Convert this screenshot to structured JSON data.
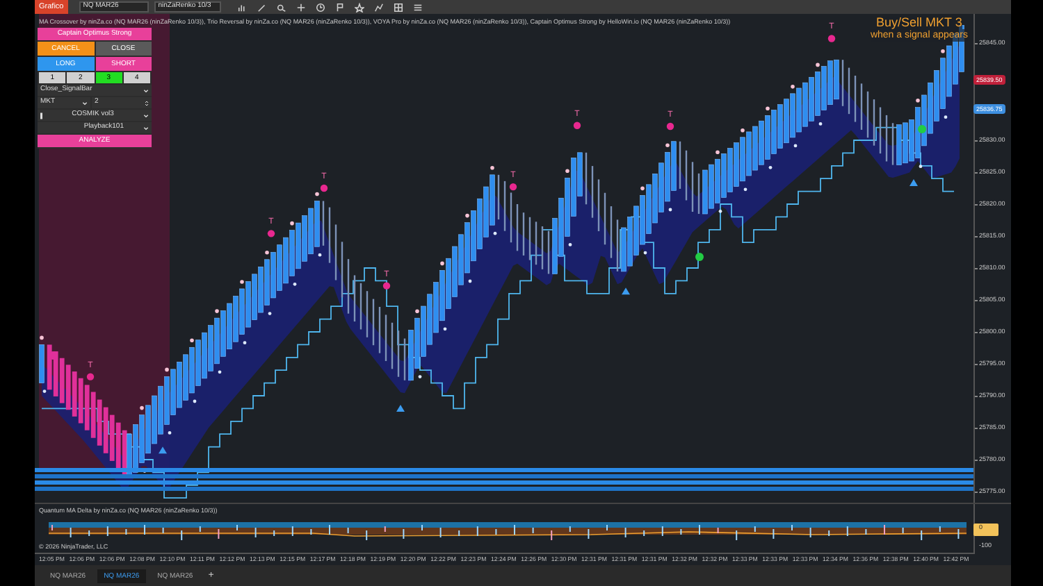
{
  "toolbar": {
    "chart_button": "Grafico",
    "instrument": "NQ MAR26",
    "bar_type": "ninZaRenko 10/3"
  },
  "legend": "MA Crossover by ninZa.co (NQ MAR26 (ninZaRenko 10/3)), Trio Reversal by ninZa.co (NQ MAR26 (ninZaRenko 10/3)), VOYA Pro by ninZa.co (NQ MAR26 (ninZaRenko 10/3)), Captain Optimus Strong by HelloWin.io (NQ MAR26 (ninZaRenko 10/3))",
  "annotation": [
    "Buy/Sell MKT 3",
    "when a signal appears"
  ],
  "panel": {
    "title": "Captain Optimus Strong",
    "buttons": [
      {
        "label": "CANCEL",
        "kind": "cancel"
      },
      {
        "label": "CLOSE",
        "kind": "close"
      },
      {
        "label": "LONG",
        "kind": "long"
      },
      {
        "label": "SHORT",
        "kind": "short"
      }
    ],
    "quantities": [
      {
        "label": "1",
        "selected": false
      },
      {
        "label": "2",
        "selected": false
      },
      {
        "label": "3",
        "selected": true
      },
      {
        "label": "4",
        "selected": false
      }
    ],
    "close_mode": "Close_SignalBar",
    "order_type": "MKT",
    "quantity": "2",
    "strategy": "COSMIK vol3",
    "account": "Playback101",
    "analyze": "ANALYZE"
  },
  "signals": [
    {
      "kind": "sell",
      "label": "T"
    },
    {
      "kind": "sell",
      "label": "T"
    },
    {
      "kind": "sell",
      "label": "T"
    },
    {
      "kind": "sell",
      "label": "T"
    },
    {
      "kind": "sell",
      "label": "T"
    },
    {
      "kind": "sell",
      "label": "T"
    },
    {
      "kind": "sell",
      "label": "T"
    },
    {
      "kind": "sell",
      "label": "T"
    },
    {
      "kind": "buy"
    },
    {
      "kind": "buy"
    },
    {
      "kind": "buy"
    },
    {
      "kind": "buy"
    }
  ],
  "price_axis": {
    "ticks": [
      "25845.00",
      "25830.00",
      "25825.00",
      "25820.00",
      "25815.00",
      "25810.00",
      "25805.00",
      "25800.00",
      "25795.00",
      "25790.00",
      "25785.00",
      "25780.00",
      "25775.00"
    ],
    "markers": [
      {
        "label": "25839.50",
        "color": "#c0203a"
      },
      {
        "label": "25836.75",
        "color": "#3d8fe0"
      }
    ]
  },
  "lower_panel": {
    "title": "Quantum MA Delta by ninZa.co (NQ MAR26 (ninZaRenko 10/3))",
    "copyright": "© 2026 NinjaTrader, LLC",
    "axis": [
      "0",
      "-100"
    ]
  },
  "time_axis": [
    "12:05 PM",
    "12:06 PM",
    "12:06 PM",
    "12:08 PM",
    "12:10 PM",
    "12:11 PM",
    "12:12 PM",
    "12:13 PM",
    "12:15 PM",
    "12:17 PM",
    "12:18 PM",
    "12:19 PM",
    "12:20 PM",
    "12:22 PM",
    "12:23 PM",
    "12:24 PM",
    "12:26 PM",
    "12:30 PM",
    "12:31 PM",
    "12:31 PM",
    "12:31 PM",
    "12:32 PM",
    "12:32 PM",
    "12:33 PM",
    "12:33 PM",
    "12:33 PM",
    "12:34 PM",
    "12:36 PM",
    "12:38 PM",
    "12:40 PM",
    "12:42 PM"
  ],
  "tabs": [
    {
      "label": "NQ MAR26",
      "selected": false
    },
    {
      "label": "NQ MAR26",
      "selected": true
    },
    {
      "label": "NQ MAR26",
      "selected": false
    }
  ],
  "add_tab": "+"
}
